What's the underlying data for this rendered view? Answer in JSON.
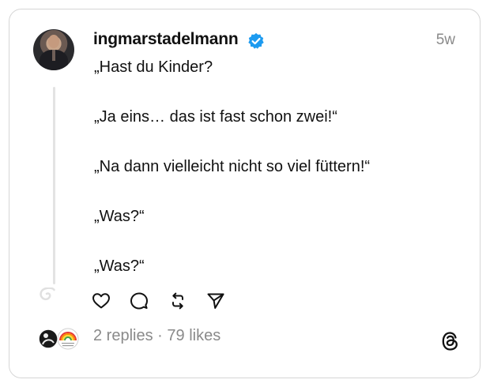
{
  "post": {
    "username": "ingmarstadelmann",
    "timestamp": "5w",
    "lines": [
      "„Hast du Kinder?",
      "„Ja eins… das ist fast schon zwei!“",
      "„Na dann vielleicht nicht so viel füttern!“",
      "„Was?“",
      "„Was?“"
    ]
  },
  "footer": {
    "replies": "2 replies",
    "separator": " · ",
    "likes": "79 likes"
  },
  "icons": {
    "verified": "verified-badge-icon",
    "like": "heart-icon",
    "reply": "comment-icon",
    "repost": "repost-icon",
    "share": "send-icon",
    "brand": "threads-logo-icon"
  },
  "colors": {
    "verified": "#1d9bf0",
    "text": "#111111",
    "muted": "#8a8a8a"
  }
}
